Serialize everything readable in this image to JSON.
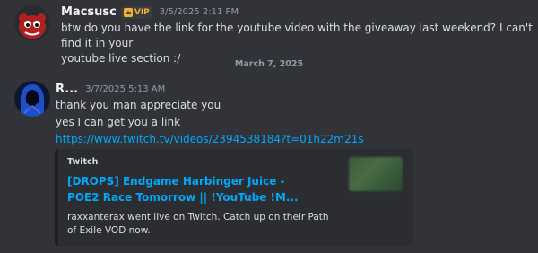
{
  "messages": [
    {
      "username": "Macsusc",
      "badge": "VIP",
      "timestamp": "3/5/2025 2:11 PM",
      "lines": [
        "btw do you have the link for the youtube video with the giveaway last weekend? I can't find it in your",
        "youtube live section :/"
      ]
    },
    {
      "username": "R...",
      "timestamp": "3/7/2025 5:13 AM",
      "lines": [
        "thank you man appreciate you",
        "yes I can get you a link"
      ],
      "link": "https://www.twitch.tv/videos/2394538184?t=01h22m21s",
      "embed": {
        "provider": "Twitch",
        "title": "[DROPS] Endgame Harbinger Juice - POE2 Race Tomorrow || !YouTube !M...",
        "description": "raxxanterax went live on Twitch. Catch up on their Path of Exile VOD now."
      }
    }
  ],
  "divider": {
    "label": "March 7, 2025"
  },
  "colors": {
    "background": "#313338",
    "link": "#00a8fc",
    "vip": "#f0b232",
    "avatar1": "#8c1c1c",
    "avatar2": "#1f4fc4"
  },
  "icons": [
    "red-monster-avatar",
    "hooded-figure-avatar",
    "crown-icon"
  ]
}
